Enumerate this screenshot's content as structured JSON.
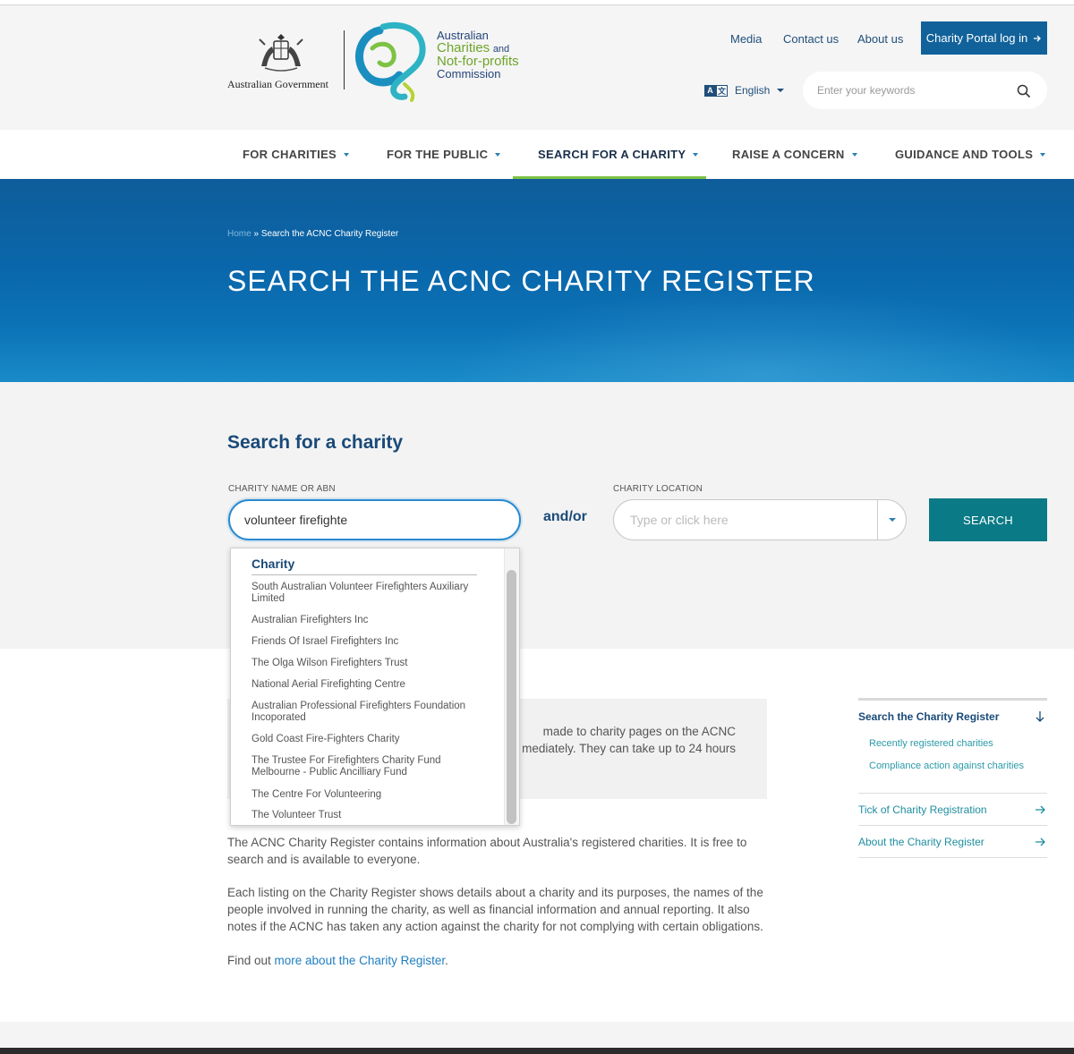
{
  "header": {
    "gov_text": "Australian Government",
    "acnc_line1": "Australian",
    "acnc_line2": "Charities",
    "acnc_line2_and": "and",
    "acnc_line3": "Not-for-profits",
    "acnc_line4": "Commission",
    "top_links": [
      {
        "label": "Media"
      },
      {
        "label": "Contact us"
      },
      {
        "label": "About us"
      }
    ],
    "portal_button": "Charity Portal log in",
    "language": "English",
    "keyword_placeholder": "Enter your keywords"
  },
  "nav": {
    "items": [
      {
        "label": "FOR CHARITIES"
      },
      {
        "label": "FOR THE PUBLIC"
      },
      {
        "label": "SEARCH FOR A CHARITY"
      },
      {
        "label": "RAISE A CONCERN"
      },
      {
        "label": "GUIDANCE AND TOOLS"
      }
    ]
  },
  "hero": {
    "breadcrumb_home": "Home",
    "breadcrumb_sep": " » ",
    "breadcrumb_current": "Search the ACNC Charity Register",
    "title": "SEARCH THE ACNC CHARITY REGISTER"
  },
  "search": {
    "heading": "Search for a charity",
    "name_label": "CHARITY NAME OR ABN",
    "name_value": "volunteer firefighte",
    "andor": "and/or",
    "location_label": "CHARITY LOCATION",
    "location_placeholder": "Type or click here",
    "button": "SEARCH"
  },
  "dropdown": {
    "heading": "Charity",
    "items": [
      {
        "label": "South Australian Volunteer Firefighters Auxiliary Limited"
      },
      {
        "label": "Australian Firefighters Inc"
      },
      {
        "label": "Friends Of Israel Firefighters Inc"
      },
      {
        "label": "The Olga Wilson Firefighters Trust"
      },
      {
        "label": "National Aerial Firefighting Centre"
      },
      {
        "label": "Australian Professional Firefighters Foundation Incoporated"
      },
      {
        "label": "Gold Coast Fire-Fighters Charity"
      },
      {
        "label": "The Trustee For Firefighters Charity Fund Melbourne - Public Ancilliary Fund"
      },
      {
        "label": "The Centre For Volunteering"
      },
      {
        "label": "The Volunteer Trust"
      }
    ]
  },
  "content": {
    "notice_line1": "made to charity pages on the ACNC",
    "notice_line2": "mediately. They can take up to 24 hours",
    "para1": "The ACNC Charity Register contains information about Australia's registered charities. It is free to search and is available to everyone.",
    "para2": "Each listing on the Charity Register shows details about a charity and its purposes, the names of the people involved in running the charity, as well as financial information and annual reporting. It also notes if the ACNC has taken any action against the charity for not complying with certain obligations.",
    "para3_prefix": "Find out ",
    "para3_link": "more about the Charity Register",
    "para3_suffix": "."
  },
  "sidebar": {
    "main": "Search the Charity Register",
    "subs": [
      {
        "label": "Recently registered charities"
      },
      {
        "label": "Compliance action against charities"
      }
    ],
    "links": [
      {
        "label": "Tick of Charity Registration"
      },
      {
        "label": "About the Charity Register"
      }
    ]
  },
  "colors": {
    "brand_blue": "#11629a",
    "search_teal": "#0a7a86",
    "nav_active_underline": "#7dc243",
    "heading_navy": "#1a4a78"
  }
}
